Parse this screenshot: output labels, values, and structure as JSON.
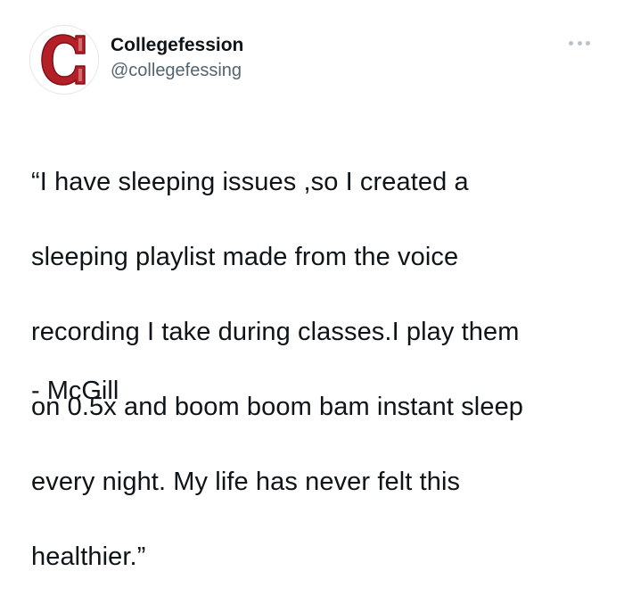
{
  "tweet": {
    "author": {
      "display_name": "Collegefession",
      "handle": "@collegefessing",
      "avatar_letter": "C",
      "avatar_color": "#b51f27"
    },
    "more_icon": "more-horizontal-icon",
    "text_lines": [
      "“I have sleeping issues ,so I created a",
      "sleeping playlist made from the voice",
      "recording I take during classes.I play them",
      "on 0.5x and  boom boom bam instant sleep",
      "every night. My life has never felt this",
      "healthier.”"
    ],
    "signature": "- McGill"
  },
  "colors": {
    "text_primary": "#0f1419",
    "text_secondary": "#536471",
    "brand_red": "#b51f27"
  }
}
